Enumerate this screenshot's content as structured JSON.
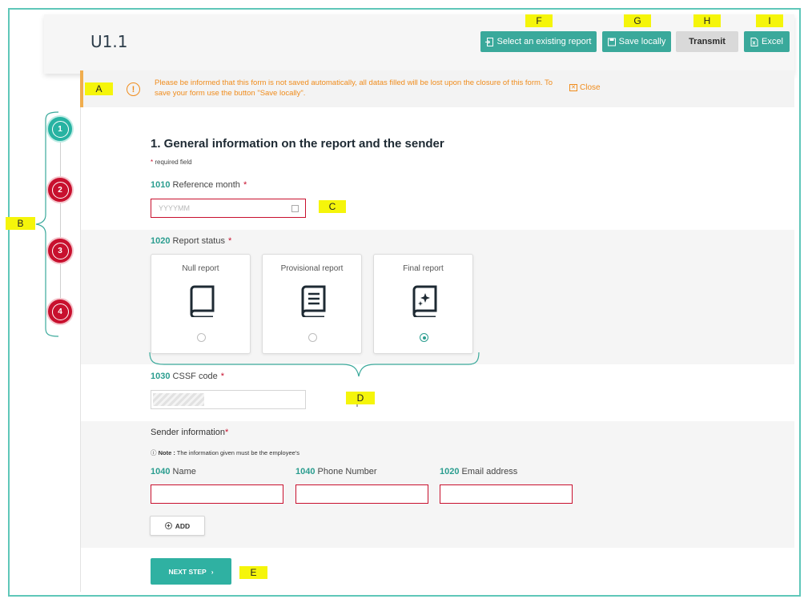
{
  "header": {
    "title": "U1.1",
    "buttons": {
      "select_report": "Select an existing report",
      "save_locally": "Save locally",
      "transmit": "Transmit",
      "excel": "Excel"
    }
  },
  "notice": {
    "text": "Please be informed that this form is not saved automatically, all datas filled will be lost upon the closure of this form. To save your form use the button \"Save locally\".",
    "close_label": "Close"
  },
  "steps": [
    {
      "number": "1",
      "state": "active"
    },
    {
      "number": "2",
      "state": "pending"
    },
    {
      "number": "3",
      "state": "pending"
    },
    {
      "number": "4",
      "state": "pending"
    }
  ],
  "form": {
    "section_title": "1. General information on the report and the sender",
    "required_note": "required field",
    "reference_month": {
      "code": "1010",
      "label": "Reference month",
      "placeholder": "YYYYMM"
    },
    "report_status": {
      "code": "1020",
      "label": "Report status",
      "options": [
        {
          "label": "Null report",
          "icon": "book-icon",
          "checked": false
        },
        {
          "label": "Provisional report",
          "icon": "book-text-icon",
          "checked": false
        },
        {
          "label": "Final report",
          "icon": "book-sparkle-icon",
          "checked": true
        }
      ]
    },
    "cssf_code": {
      "code": "1030",
      "label": "CSSF code"
    },
    "sender": {
      "title": "Sender information",
      "note_prefix": "Note :",
      "note_text": "The information given must be the employee's",
      "fields": [
        {
          "code": "1040",
          "label": "Name"
        },
        {
          "code": "1040",
          "label": "Phone Number"
        },
        {
          "code": "1020",
          "label": "Email address"
        }
      ],
      "add_label": "ADD"
    },
    "next_label": "NEXT STEP"
  },
  "annotations": {
    "A": "A",
    "B": "B",
    "C": "C",
    "D": "D",
    "E": "E",
    "F": "F",
    "G": "G",
    "H": "H",
    "I": "I"
  },
  "colors": {
    "accent": "#3aa99b",
    "error": "#c8102e",
    "warning": "#f08c1c",
    "highlight": "#f5f50a"
  }
}
